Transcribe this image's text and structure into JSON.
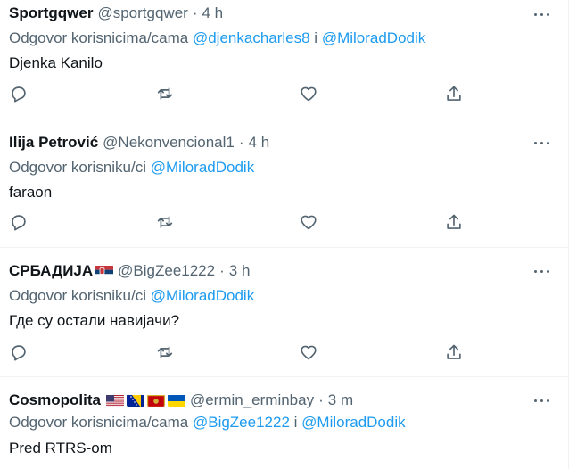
{
  "tweets": [
    {
      "name": "Sportgqwer",
      "handle": "@sportgqwer",
      "dot": "·",
      "time": "4 h",
      "reply_prefix": "Odgovor korisnicima/cama ",
      "mention1": "@djenkacharles8",
      "joiner": " i ",
      "mention2": "@MiloradDodik",
      "text": "Djenka Kanilo"
    },
    {
      "name": "Ilija Petrović",
      "handle": "@Nekonvencional1",
      "dot": "·",
      "time": "4 h",
      "reply_prefix": "Odgovor korisniku/ci ",
      "mention1": "@MiloradDodik",
      "text": "faraon"
    },
    {
      "name": "СРБАДИЈА",
      "handle": "@BigZee1222",
      "dot": "·",
      "time": "3 h",
      "reply_prefix": "Odgovor korisniku/ci ",
      "mention1": "@MiloradDodik",
      "text": "Где су остали навијачи?",
      "flags": [
        "serbia-flag"
      ]
    },
    {
      "name": "Cosmopolita",
      "handle": "@ermin_erminbay",
      "dot": "·",
      "time": "3 m",
      "reply_prefix": "Odgovor korisnicima/cama ",
      "mention1": "@BigZee1222",
      "joiner": " i ",
      "mention2": "@MiloradDodik",
      "text": "Pred RTRS-om",
      "flags": [
        "usa-flag",
        "bosnia-flag",
        "montenegro-flag",
        "ukraine-flag"
      ]
    }
  ],
  "icons": {
    "reply": "reply-icon",
    "retweet": "retweet-icon",
    "like": "like-icon",
    "share": "share-icon",
    "more": "more-icon"
  },
  "colors": {
    "text": "#0f1419",
    "secondary": "#536471",
    "link": "#1d9bf0",
    "divider": "#eff3f4"
  }
}
